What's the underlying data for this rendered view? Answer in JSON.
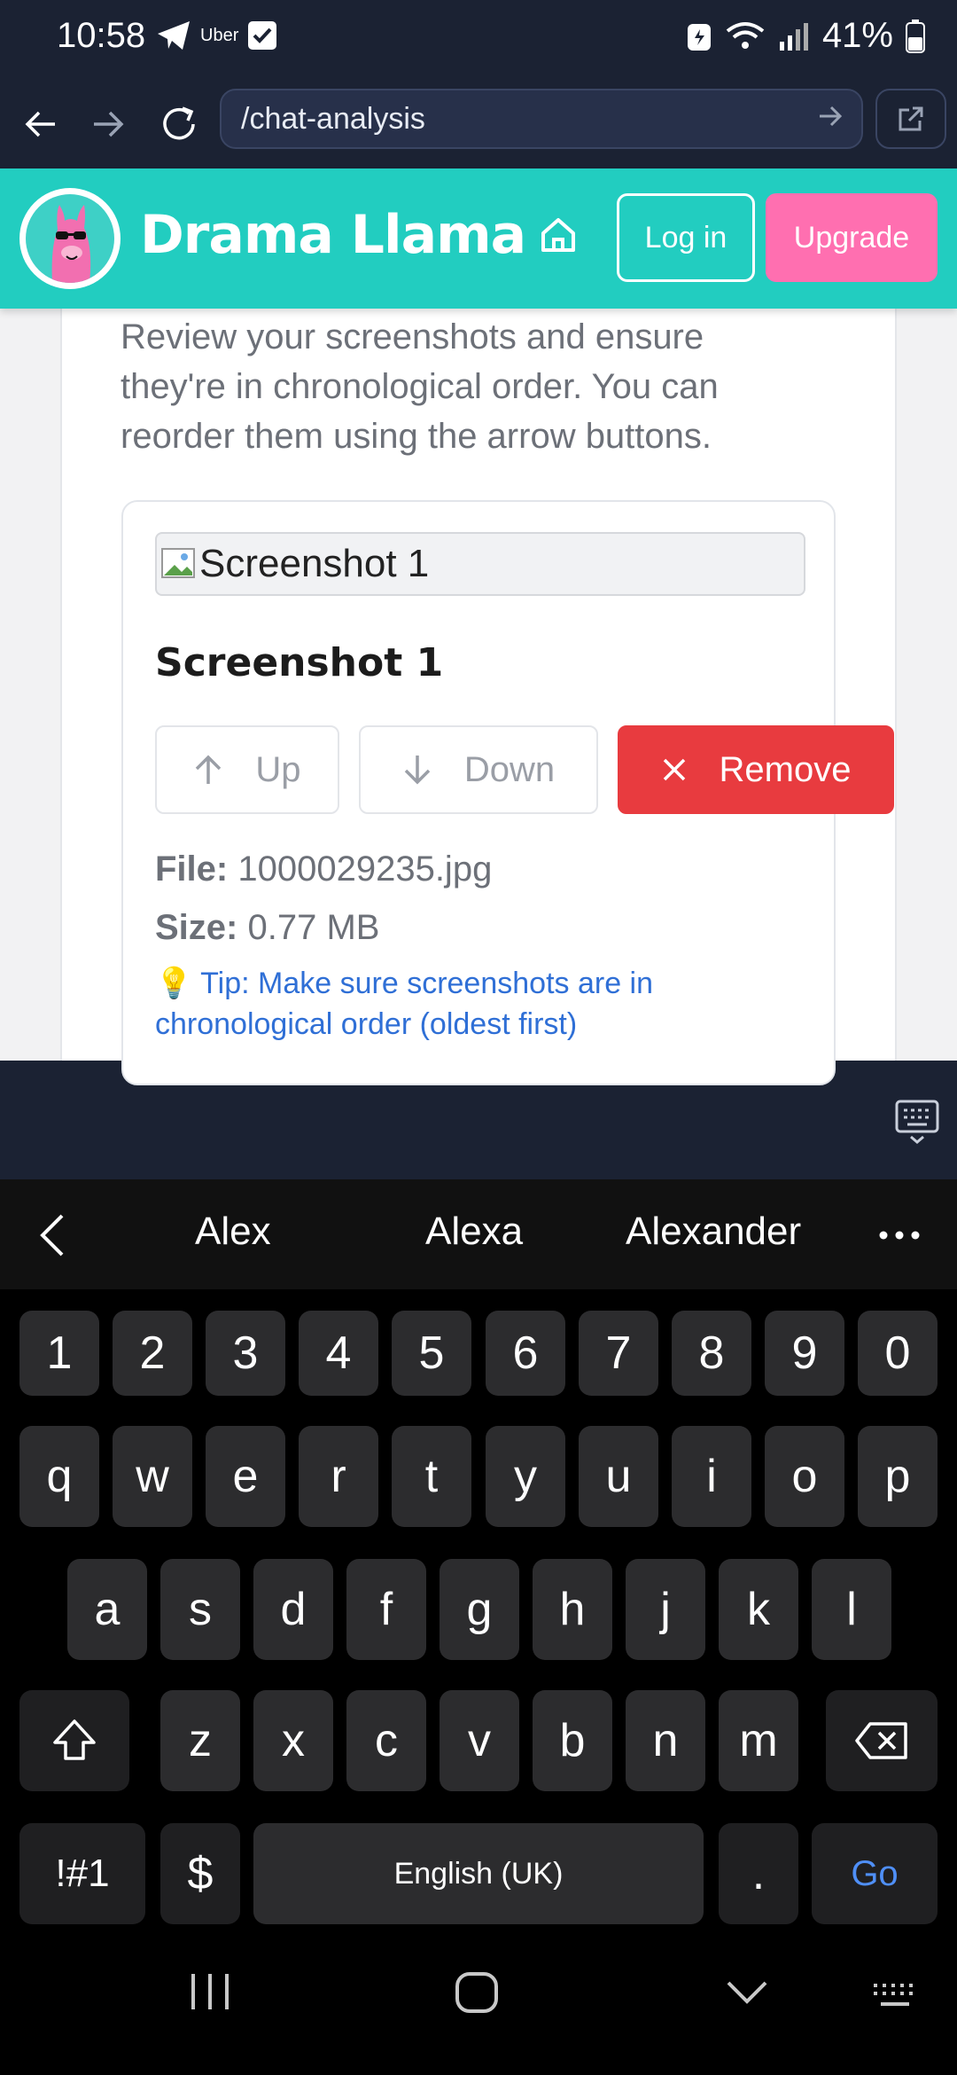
{
  "status_bar": {
    "time": "10:58",
    "uber_label": "Uber",
    "battery": "41%"
  },
  "browser": {
    "url": "/chat-analysis"
  },
  "header": {
    "brand": "Drama Llama",
    "login_label": "Log in",
    "upgrade_label": "Upgrade"
  },
  "content": {
    "intro": "Review your screenshots and ensure they're in chronological order. You can reorder them using the arrow buttons.",
    "screenshot": {
      "image_alt": "Screenshot 1",
      "title": "Screenshot 1",
      "up_label": "Up",
      "down_label": "Down",
      "remove_label": "Remove",
      "file_label": "File:",
      "file_value": "1000029235.jpg",
      "size_label": "Size:",
      "size_value": "0.77 MB",
      "tip": "💡 Tip: Make sure screenshots are in chronological order (oldest first)"
    }
  },
  "keyboard": {
    "suggestions": [
      "Alex",
      "Alexa",
      "Alexander"
    ],
    "row_numbers": [
      "1",
      "2",
      "3",
      "4",
      "5",
      "6",
      "7",
      "8",
      "9",
      "0"
    ],
    "row_q": [
      "q",
      "w",
      "e",
      "r",
      "t",
      "y",
      "u",
      "i",
      "o",
      "p"
    ],
    "row_a": [
      "a",
      "s",
      "d",
      "f",
      "g",
      "h",
      "j",
      "k",
      "l"
    ],
    "row_z": [
      "z",
      "x",
      "c",
      "v",
      "b",
      "n",
      "m"
    ],
    "symbols_label": "!#1",
    "currency_label": "$",
    "space_label": "English (UK)",
    "period_label": ".",
    "go_label": "Go"
  },
  "colors": {
    "header_teal": "#22cdc0",
    "upgrade_pink": "#ff6fb0",
    "remove_red": "#e83b3f",
    "tip_blue": "#2f6fd6",
    "go_blue": "#4f8ff7"
  }
}
